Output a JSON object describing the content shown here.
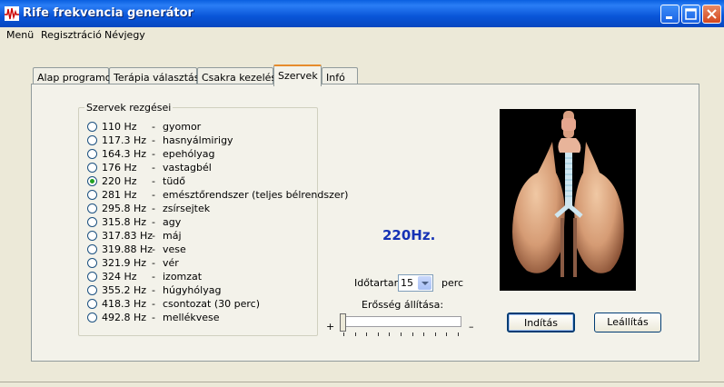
{
  "window": {
    "title": "Rife frekvencia generátor"
  },
  "menu": [
    "Menü",
    "Regisztráció",
    "Névjegy"
  ],
  "tabs": [
    "Alap programok",
    "Terápia választás",
    "Csakra kezelés",
    "Szervek",
    "Infó"
  ],
  "active_tab": 3,
  "group": {
    "title": "Szervek rezgései",
    "items": [
      {
        "freq": "110 Hz",
        "organ": "gyomor",
        "checked": false
      },
      {
        "freq": "117.3 Hz",
        "organ": "hasnyálmirigy",
        "checked": false
      },
      {
        "freq": "164.3 Hz",
        "organ": "epehólyag",
        "checked": false
      },
      {
        "freq": "176 Hz",
        "organ": "vastagbél",
        "checked": false
      },
      {
        "freq": "220 Hz",
        "organ": "tüdő",
        "checked": true
      },
      {
        "freq": "281 Hz",
        "organ": "emésztőrendszer (teljes bélrendszer)",
        "checked": false
      },
      {
        "freq": "295.8 Hz",
        "organ": "zsírsejtek",
        "checked": false
      },
      {
        "freq": "315.8 Hz",
        "organ": "agy",
        "checked": false
      },
      {
        "freq": "317.83 Hz",
        "organ": "máj",
        "checked": false
      },
      {
        "freq": "319.88 Hz",
        "organ": "vese",
        "checked": false
      },
      {
        "freq": "321.9 Hz",
        "organ": "vér",
        "checked": false
      },
      {
        "freq": "324 Hz",
        "organ": "izomzat",
        "checked": false
      },
      {
        "freq": "355.2 Hz",
        "organ": "húgyhólyag",
        "checked": false
      },
      {
        "freq": "418.3 Hz",
        "organ": "csontozat  (30 perc)",
        "checked": false
      },
      {
        "freq": "492.8 Hz",
        "organ": "mellékvese",
        "checked": false
      }
    ],
    "separator": "-"
  },
  "display_freq": "220Hz.",
  "image": {
    "icon": "lungs-illustration"
  },
  "duration": {
    "label": "Időtartam:",
    "value": "15",
    "unit": "perc"
  },
  "strength": {
    "label": "Erősség állítása:",
    "plus": "+",
    "minus": "–",
    "level_fraction": 0.0
  },
  "buttons": {
    "start": "Indítás",
    "stop": "Leállítás"
  },
  "colors": {
    "accent_freq": "#1532b5",
    "titlebar": "#0a5fe0"
  }
}
